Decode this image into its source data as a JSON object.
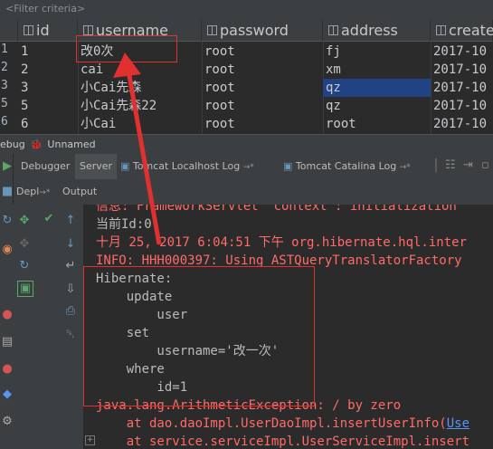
{
  "filter": {
    "placeholder": "<Filter criteria>"
  },
  "grid": {
    "columns": [
      "id",
      "username",
      "password",
      "address",
      "create"
    ],
    "row_numbers": [
      "1",
      "2",
      "3",
      "5",
      "6"
    ],
    "rows": [
      [
        "1",
        "改0次",
        "root",
        "fj",
        "2017-10"
      ],
      [
        "2",
        "cai",
        "root",
        "xm",
        "2017-10"
      ],
      [
        "3",
        "小Cai先森",
        "root",
        "qz",
        "2017-10"
      ],
      [
        "5",
        "小Cai先森22",
        "root",
        "qz",
        "2017-10"
      ],
      [
        "6",
        "小Cai",
        "root",
        "root",
        "2017-10"
      ]
    ]
  },
  "debug": {
    "label": "ebug",
    "config_name": "Unnamed"
  },
  "toolwindow": {
    "tabs": [
      "Debugger",
      "Server",
      "Tomcat Localhost Log",
      "Tomcat Catalina Log"
    ],
    "pin_marks": [
      "→*",
      "→*"
    ],
    "subtabs": [
      "Depl",
      "Output"
    ],
    "subtab_arrow": "→*"
  },
  "console": {
    "lines": [
      {
        "text": "信息: FrameworkServlet 'context': initialization",
        "style": "red"
      },
      {
        "text": "当前Id:0",
        "style": "norm"
      },
      {
        "text": "十月 25, 2017 6:04:51 下午 org.hibernate.hql.inter",
        "style": "red"
      },
      {
        "text": "INFO: HHH000397: Using ASTQueryTranslatorFactory",
        "style": "red"
      },
      {
        "text": "Hibernate:",
        "style": "norm"
      },
      {
        "text": "    update",
        "style": "norm"
      },
      {
        "text": "        user",
        "style": "norm"
      },
      {
        "text": "    set",
        "style": "norm"
      },
      {
        "text": "        username='改一次'",
        "style": "norm"
      },
      {
        "text": "    where",
        "style": "norm"
      },
      {
        "text": "        id=1",
        "style": "norm"
      },
      {
        "text": "java.lang.ArithmeticException: / by zero",
        "style": "red"
      },
      {
        "prefix": "    at dao.daoImpl.UserDaoImpl.insertUserInfo(",
        "link": "Use",
        "style": "red"
      },
      {
        "prefix": "    at service.serviceImpl.UserServiceImpl.insert",
        "link": "",
        "style": "red"
      }
    ]
  },
  "colors": {
    "background": "#2b2b2b",
    "panel": "#3c3f41",
    "error_red": "#ff6b68",
    "annotation_red": "#e03030",
    "selection": "#214283"
  }
}
